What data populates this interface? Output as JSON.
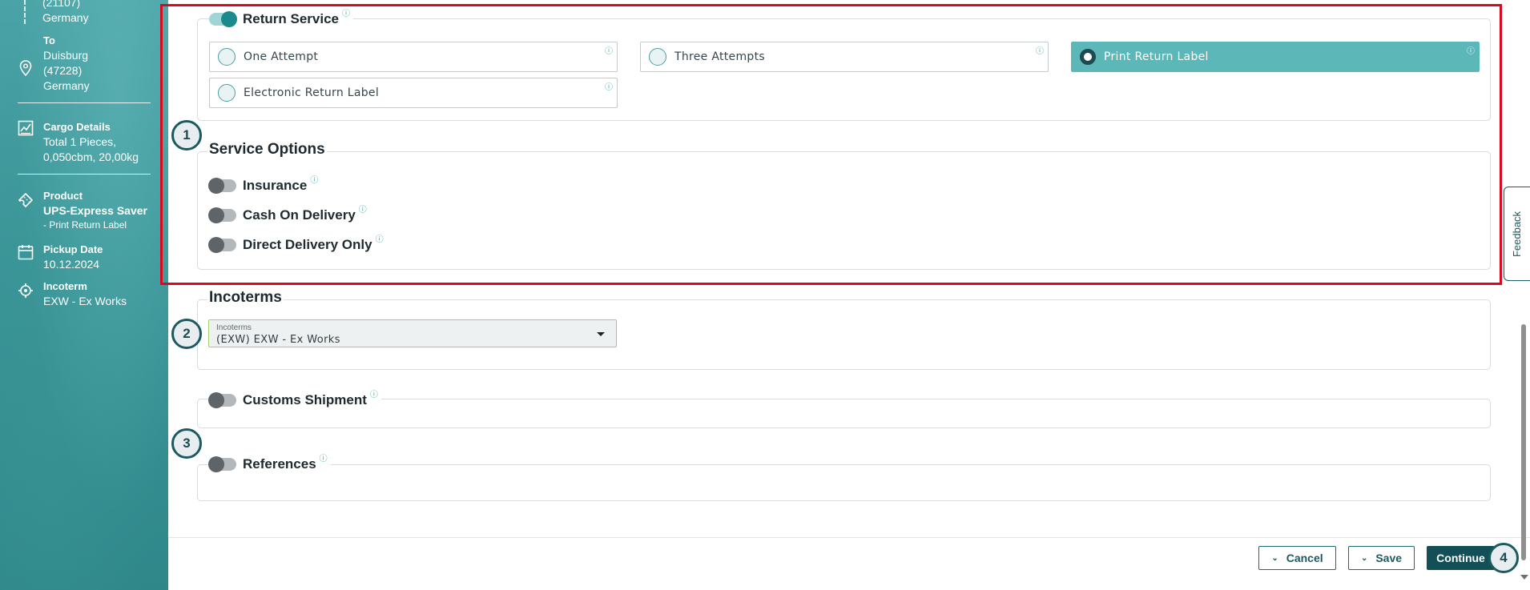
{
  "sidebar": {
    "from_postcode": "(21107)",
    "from_country": "Germany",
    "to": {
      "label": "To",
      "city": "Duisburg",
      "postcode": "(47228)",
      "country": "Germany"
    },
    "cargo": {
      "label": "Cargo Details",
      "line1": "Total 1 Pieces,",
      "line2": "0,050cbm, 20,00kg"
    },
    "product": {
      "label": "Product",
      "name": "UPS-Express Saver",
      "sub": "- Print Return Label"
    },
    "pickup": {
      "label": "Pickup Date",
      "value": "10.12.2024"
    },
    "incoterm": {
      "label": "Incoterm",
      "value": "EXW - Ex Works"
    }
  },
  "return_service": {
    "label": "Return Service",
    "enabled": true,
    "options": [
      {
        "label": "One Attempt",
        "selected": false
      },
      {
        "label": "Three Attempts",
        "selected": false
      },
      {
        "label": "Print Return Label",
        "selected": true
      },
      {
        "label": "Electronic Return Label",
        "selected": false
      }
    ]
  },
  "service_options": {
    "title": "Service Options",
    "items": [
      {
        "label": "Insurance",
        "enabled": false
      },
      {
        "label": "Cash On Delivery",
        "enabled": false
      },
      {
        "label": "Direct Delivery Only",
        "enabled": false
      }
    ]
  },
  "incoterms": {
    "title": "Incoterms",
    "field_label": "Incoterms",
    "value": "(EXW) EXW - Ex Works"
  },
  "customs_shipment": {
    "label": "Customs Shipment",
    "enabled": false
  },
  "references": {
    "label": "References",
    "enabled": false
  },
  "info_glyph": "ⓘ",
  "steps": [
    "1",
    "2",
    "3",
    "4"
  ],
  "footer": {
    "cancel_label": "Cancel",
    "save_label": "Save",
    "continue_label": "Continue"
  },
  "feedback_label": "Feedback",
  "colors": {
    "accent": "#1a8a8c",
    "selected_option": "#5cb7b9",
    "highlight": "#d9091f",
    "primary_button": "#124f56"
  }
}
